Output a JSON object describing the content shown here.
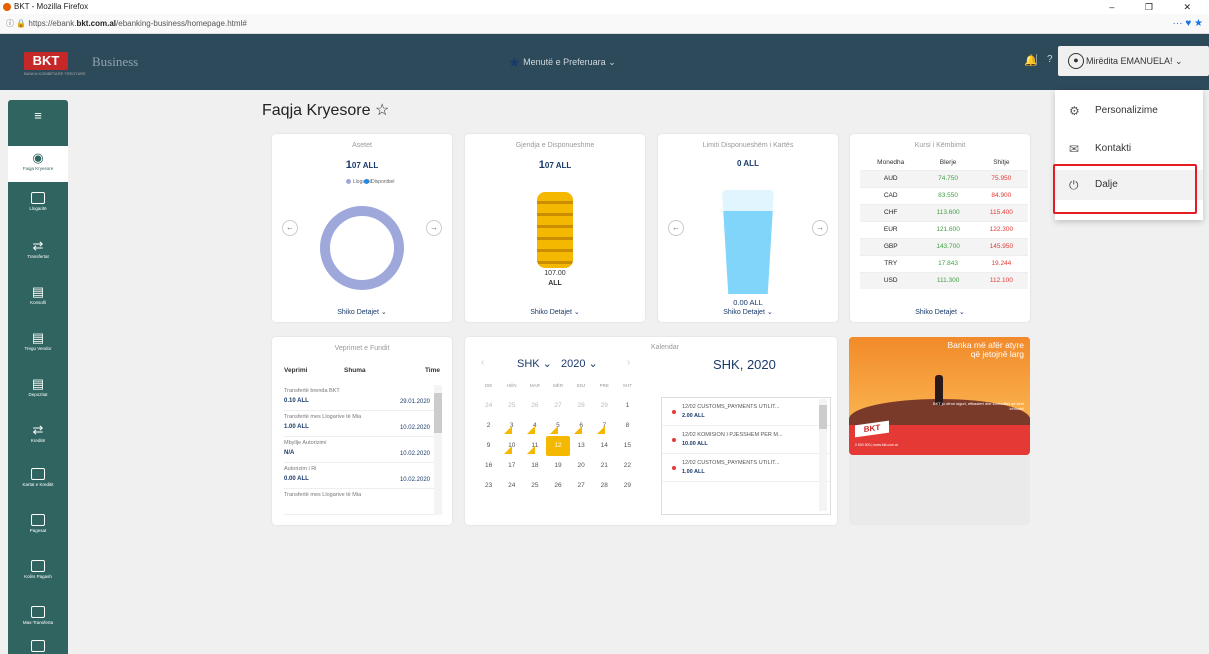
{
  "browser": {
    "title": "BKT - Mozilla Firefox",
    "url_pre": "https://ebank.",
    "url_domain": "bkt.com.al",
    "url_post": "/ebanking-business/homepage.html#",
    "controls": "– ❐ ✕",
    "tools": "··· ♥ ★"
  },
  "header": {
    "logo": "BKT",
    "logo_sub": "BANKA KOMBËTARE TREGTARE",
    "business": "Business",
    "favorites": "Menutë e Preferuara",
    "favorites_chevron": "⌄",
    "help": "?",
    "user": "Mirëdita EMANUELA!",
    "user_chevron": "⌄"
  },
  "sidebar": {
    "items": [
      {
        "label": "",
        "icon": "menu-icon"
      },
      {
        "label": "Faqja Kryesore",
        "icon": "home-icon"
      },
      {
        "label": "Llogaritë",
        "icon": "accounts-icon"
      },
      {
        "label": "Transfertat",
        "icon": "transfer-icon"
      },
      {
        "label": "Konsolli",
        "icon": "console-icon"
      },
      {
        "label": "Tregu Vendor",
        "icon": "market-icon"
      },
      {
        "label": "Depozitat",
        "icon": "deposit-icon"
      },
      {
        "label": "Kreditë",
        "icon": "credit-icon"
      },
      {
        "label": "Kartat e Kreditit",
        "icon": "card-icon"
      },
      {
        "label": "Pagesat",
        "icon": "payments-icon"
      },
      {
        "label": "Kolirs Pagash",
        "icon": "payroll-icon"
      },
      {
        "label": "Mas-Transferta",
        "icon": "mass-transfer-icon"
      },
      {
        "label": "",
        "icon": "more-icon"
      }
    ]
  },
  "page": {
    "title": "Faqja Kryesore",
    "star": "☆"
  },
  "cards": {
    "assets": {
      "title": "Asetet",
      "amount_big": "1",
      "amount": "07 ALL",
      "legend_1": "Llogaritë",
      "legend_2": "Disponibel",
      "details": "Shiko Detajet ⌄"
    },
    "available": {
      "title": "Gjendja e Disponueshme",
      "amount_big": "1",
      "amount": "07 ALL",
      "value": "107.00",
      "currency": "ALL",
      "details": "Shiko Detajet ⌄"
    },
    "card_limit": {
      "title": "Limiti Disponueshëm i Kartës",
      "amount": "0 ALL",
      "value": "0.00 ALL",
      "details": "Shiko Detajet ⌄"
    },
    "rates": {
      "title": "Kursi i Këmbimit",
      "headers": [
        "Monedha",
        "Blerje",
        "Shitje"
      ],
      "rows": [
        [
          "AUD",
          "74.750",
          "75.950"
        ],
        [
          "CAD",
          "83.550",
          "84.900"
        ],
        [
          "CHF",
          "113.600",
          "115.400"
        ],
        [
          "EUR",
          "121.600",
          "122.300"
        ],
        [
          "GBP",
          "143.700",
          "145.950"
        ],
        [
          "TRY",
          "17.843",
          "19.244"
        ],
        [
          "USD",
          "111.300",
          "112.100"
        ]
      ],
      "details": "Shiko Detajet ⌄"
    },
    "transactions": {
      "title": "Veprimet e Fundit",
      "headers": [
        "Veprimi",
        "Shuma",
        "Time"
      ],
      "items": [
        {
          "desc": "Transfertë brenda BKT",
          "amount": "0.10 ALL",
          "date": "29.01.2020"
        },
        {
          "desc": "Transfertë mes Llogarive të Mia",
          "amount": "1.00 ALL",
          "date": "10.02.2020"
        },
        {
          "desc": "Mbyllje Autorizimi",
          "amount": "N/A",
          "date": "10.02.2020"
        },
        {
          "desc": "Autorizim i Ri",
          "amount": "0.00 ALL",
          "date": "10.02.2020"
        },
        {
          "desc": "Transfertë mes Llogarive të Mia",
          "amount": "",
          "date": ""
        }
      ]
    },
    "calendar": {
      "title": "Kalendar",
      "month": "SHK ⌄",
      "year": "2020 ⌄",
      "heading": "SHK, 2020",
      "dow": [
        "DIE",
        "HËN",
        "MAR",
        "MËR",
        "ENJ",
        "PRE",
        "SHT"
      ],
      "weeks": [
        [
          "24",
          "25",
          "26",
          "27",
          "28",
          "29",
          "1"
        ],
        [
          "2",
          "3",
          "4",
          "5",
          "6",
          "7",
          "8"
        ],
        [
          "9",
          "10",
          "11",
          "12",
          "13",
          "14",
          "15"
        ],
        [
          "16",
          "17",
          "18",
          "19",
          "20",
          "21",
          "22"
        ],
        [
          "23",
          "24",
          "25",
          "26",
          "27",
          "28",
          "29"
        ]
      ],
      "events": [
        {
          "title": "12/02 CUSTOMS_PAYMENTS UTILIT...",
          "amount": "2.00 ALL"
        },
        {
          "title": "12/02 KOMISION I PJESSHEM PER M...",
          "amount": "10.00 ALL"
        },
        {
          "title": "12/02 CUSTOMS_PAYMENTS UTILIT...",
          "amount": "1.00 ALL"
        }
      ]
    },
    "ad": {
      "title": "Banka më afër atyre që jetojnë larg",
      "text": "BKT ju ofron siguri, efikasitet dhe komoditet që keni kërkuar!",
      "logo": "BKT",
      "foot": "0 800 800 | www.bkt.com.al"
    }
  },
  "dropdown": {
    "items": [
      {
        "label": "Personalizime",
        "icon": "⚙"
      },
      {
        "label": "Kontakti",
        "icon": "✉"
      },
      {
        "label": "Dalje",
        "icon": "⏻"
      }
    ]
  }
}
